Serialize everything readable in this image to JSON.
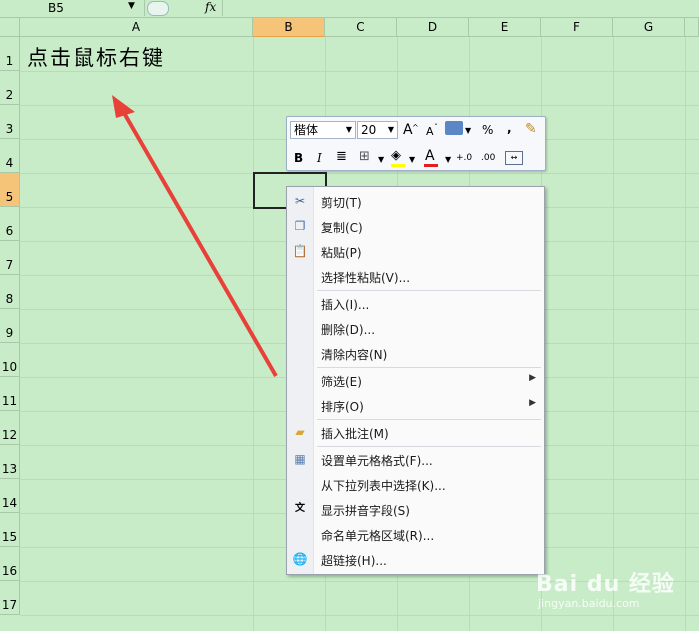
{
  "formula_bar": {
    "name_box": "B5",
    "fx": "fx"
  },
  "columns": [
    {
      "label": "A",
      "selected": false
    },
    {
      "label": "B",
      "selected": true
    },
    {
      "label": "C",
      "selected": false
    },
    {
      "label": "D",
      "selected": false
    },
    {
      "label": "E",
      "selected": false
    },
    {
      "label": "F",
      "selected": false
    },
    {
      "label": "G",
      "selected": false
    }
  ],
  "rows": [
    "1",
    "2",
    "3",
    "4",
    "5",
    "6",
    "7",
    "8",
    "9",
    "10",
    "11",
    "12",
    "13",
    "14",
    "15",
    "16",
    "17"
  ],
  "cell_a1": "点击鼠标右键",
  "mini_toolbar": {
    "font_name": "楷体",
    "font_size": "20",
    "grow_font": "A",
    "shrink_font": "A",
    "percent": "%",
    "comma": ",",
    "bold": "B",
    "italic": "I",
    "font_color_letter": "A",
    "inc_decimal": "+.0",
    "dec_decimal": ".00"
  },
  "context_menu": {
    "items": [
      {
        "label": "剪切(T)",
        "icon": "scissors-icon"
      },
      {
        "label": "复制(C)",
        "icon": "copy-icon"
      },
      {
        "label": "粘贴(P)",
        "icon": "paste-icon"
      },
      {
        "label": "选择性粘贴(V)...",
        "icon": ""
      },
      {
        "label": "插入(I)...",
        "icon": ""
      },
      {
        "label": "删除(D)...",
        "icon": ""
      },
      {
        "label": "清除内容(N)",
        "icon": ""
      },
      {
        "label": "筛选(E)",
        "icon": "",
        "submenu": true
      },
      {
        "label": "排序(O)",
        "icon": "",
        "submenu": true
      },
      {
        "label": "插入批注(M)",
        "icon": "comment-icon"
      },
      {
        "label": "设置单元格格式(F)...",
        "icon": "format-cells-icon"
      },
      {
        "label": "从下拉列表中选择(K)...",
        "icon": ""
      },
      {
        "label": "显示拼音字段(S)",
        "icon": "phonetic-icon"
      },
      {
        "label": "命名单元格区域(R)...",
        "icon": ""
      },
      {
        "label": "超链接(H)...",
        "icon": "hyperlink-icon"
      }
    ]
  },
  "watermark": {
    "brand": "Bai du 经验",
    "url": "jingyan.baidu.com"
  },
  "colors": {
    "sheet_bg": "#c8ecc8",
    "selected_header": "#f5c478",
    "arrow": "#e8413a"
  }
}
